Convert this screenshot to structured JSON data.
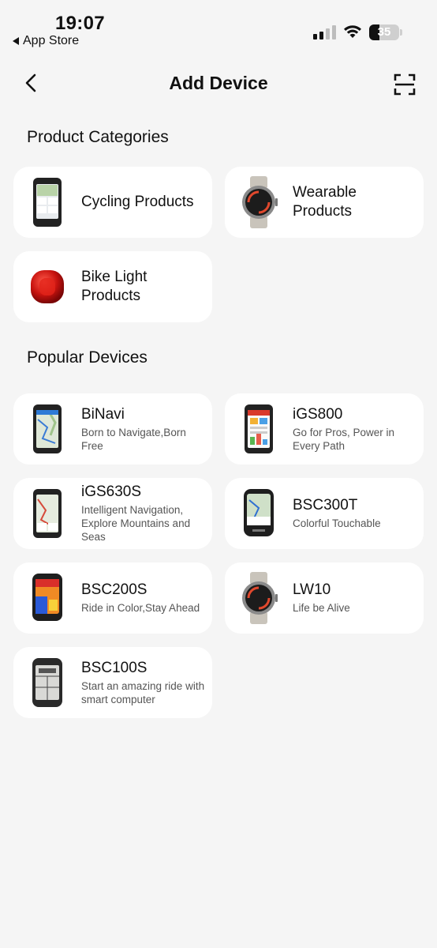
{
  "status_bar": {
    "time": "19:07",
    "back_app": "App Store",
    "battery_level": "35",
    "battery_fraction": 0.35
  },
  "nav": {
    "title": "Add Device"
  },
  "product_categories": {
    "title": "Product Categories",
    "items": [
      {
        "label": "Cycling Products",
        "icon": "bike-computer-icon"
      },
      {
        "label": "Wearable Products",
        "icon": "smartwatch-icon"
      },
      {
        "label": "Bike Light Products",
        "icon": "bike-light-icon"
      }
    ]
  },
  "popular_devices": {
    "title": "Popular Devices",
    "items": [
      {
        "name": "BiNavi",
        "desc": "Born to Navigate,Born Free",
        "icon": "bike-computer-map-icon"
      },
      {
        "name": "iGS800",
        "desc": "Go for Pros, Power in Every Path",
        "icon": "bike-computer-color-icon"
      },
      {
        "name": "iGS630S",
        "desc": "Intelligent Navigation, Explore Mountains and Seas",
        "icon": "bike-computer-map-icon"
      },
      {
        "name": "BSC300T",
        "desc": "Colorful Touchable",
        "icon": "bike-computer-touch-icon"
      },
      {
        "name": "BSC200S",
        "desc": "Ride in Color,Stay Ahead",
        "icon": "bike-computer-color-icon"
      },
      {
        "name": "LW10",
        "desc": "Life be Alive",
        "icon": "smartwatch-icon"
      },
      {
        "name": "BSC100S",
        "desc": "Start an amazing ride with smart computer",
        "icon": "bike-computer-mono-icon"
      }
    ]
  },
  "colors": {
    "background": "#f5f5f5",
    "card": "#ffffff",
    "text": "#111111",
    "subtext": "#555555",
    "light_red": "#d11a1a"
  }
}
